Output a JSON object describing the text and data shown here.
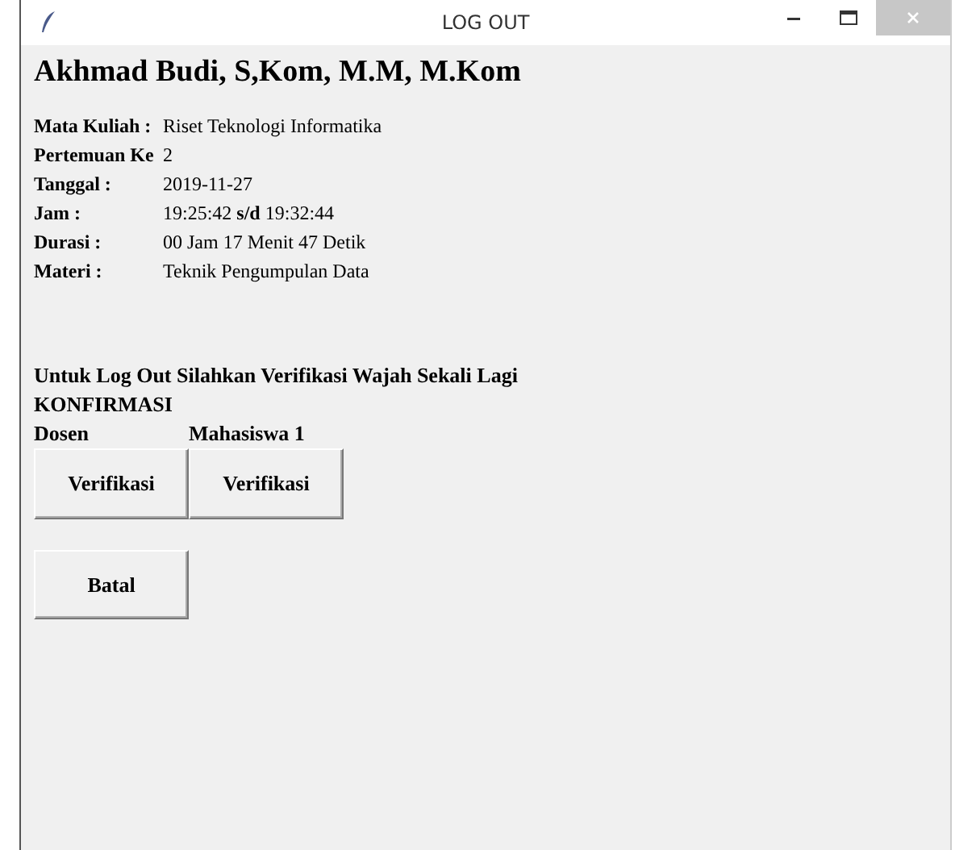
{
  "window": {
    "title": "LOG OUT"
  },
  "name": "Akhmad Budi, S,Kom, M.M, M.Kom",
  "info": [
    {
      "label": "Mata Kuliah :",
      "value": "Riset Teknologi Informatika"
    },
    {
      "label": "Pertemuan Ke",
      "value": "2"
    },
    {
      "label": "Tanggal :",
      "value": "2019-11-27"
    },
    {
      "label": "Jam :",
      "value": "19:25:42 **s/d** 19:32:44"
    },
    {
      "label": "Durasi :",
      "value": "00 Jam 17 Menit 47 Detik"
    },
    {
      "label": "Materi :",
      "value": "Teknik Pengumpulan Data"
    }
  ],
  "instruction": "Untuk Log Out Silahkan Verifikasi Wajah Sekali Lagi",
  "confirm_title": "KONFIRMASI",
  "verifiers": [
    {
      "label": "Dosen",
      "button": "Verifikasi"
    },
    {
      "label": "Mahasiswa 1",
      "button": "Verifikasi"
    }
  ],
  "cancel_button": "Batal"
}
